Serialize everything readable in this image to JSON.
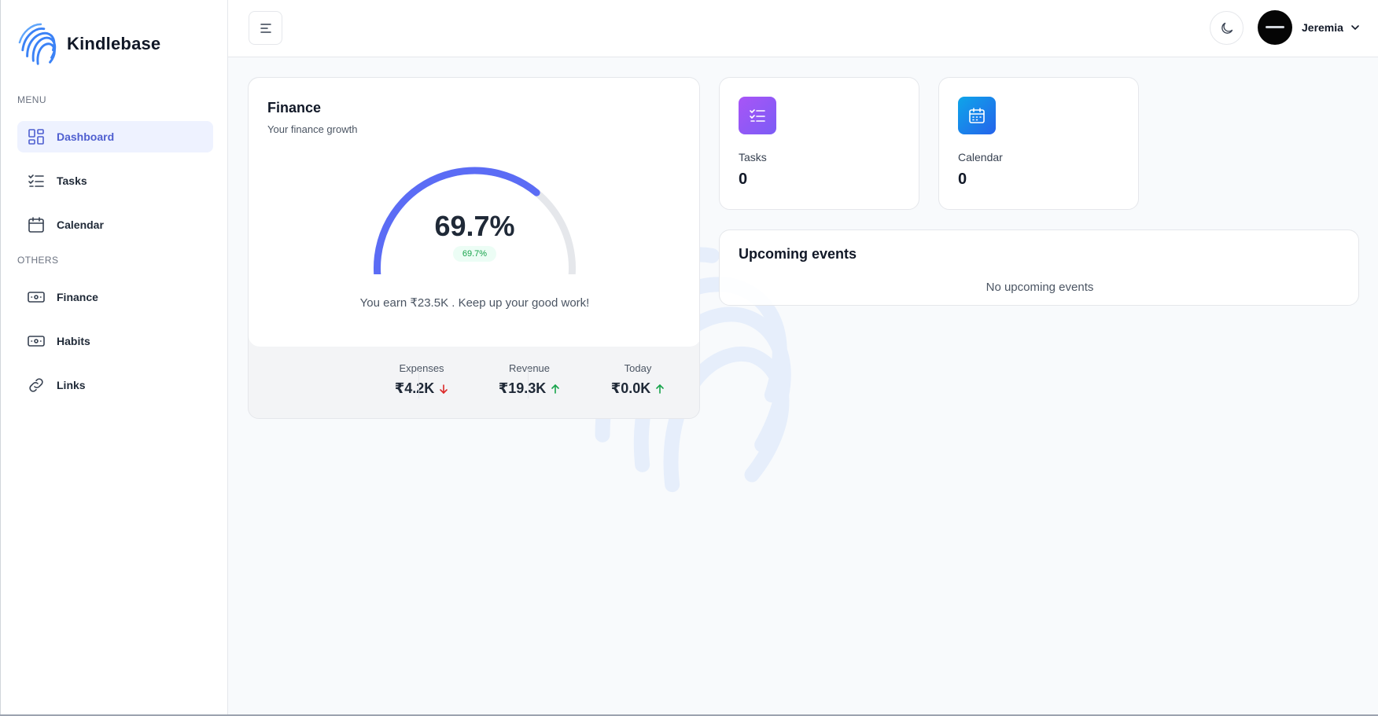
{
  "brand": {
    "name": "Kindlebase"
  },
  "sidebar": {
    "menu_label": "MENU",
    "others_label": "OTHERS",
    "menu_items": [
      {
        "label": "Dashboard",
        "icon": "dashboard-icon",
        "active": true
      },
      {
        "label": "Tasks",
        "icon": "tasks-icon"
      },
      {
        "label": "Calendar",
        "icon": "calendar-icon"
      }
    ],
    "other_items": [
      {
        "label": "Finance",
        "icon": "money-icon"
      },
      {
        "label": "Habits",
        "icon": "money-icon"
      },
      {
        "label": "Links",
        "icon": "link-icon"
      }
    ]
  },
  "header": {
    "user_name": "Jeremia"
  },
  "finance": {
    "title": "Finance",
    "subtitle": "Your finance growth",
    "gauge_percent": 69.7,
    "gauge_label": "69.7%",
    "badge": "69.7%",
    "earn_text": "You earn ₹23.5K . Keep up your good work!",
    "stats": [
      {
        "label": "Expenses",
        "value": "₹4.2K",
        "trend": "down"
      },
      {
        "label": "Revenue",
        "value": "₹19.3K",
        "trend": "up"
      },
      {
        "label": "Today",
        "value": "₹0.0K",
        "trend": "up"
      }
    ]
  },
  "tasks_card": {
    "label": "Tasks",
    "value": "0"
  },
  "calendar_card": {
    "label": "Calendar",
    "value": "0"
  },
  "events": {
    "title": "Upcoming events",
    "empty_text": "No upcoming events"
  },
  "colors": {
    "accent": "#5b6cf5",
    "active_nav_bg": "#eef2ff",
    "trend_up": "#16a34a",
    "trend_down": "#dc2626"
  }
}
